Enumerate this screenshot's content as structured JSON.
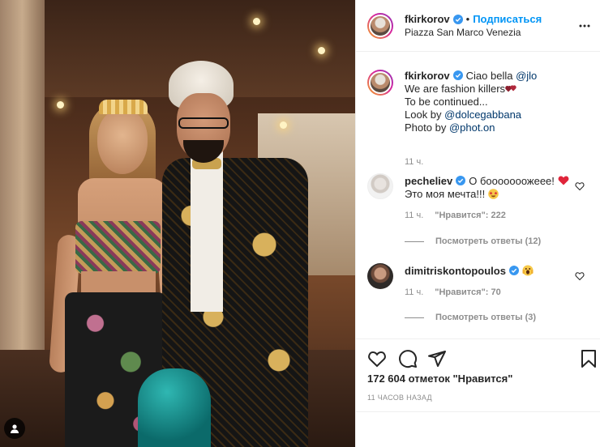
{
  "post": {
    "author": "fkirkorov",
    "follow_label": "Подписаться",
    "separator": "•",
    "location": "Piazza San Marco Venezia"
  },
  "caption": {
    "username": "fkirkorov",
    "line1_text": "Ciao bella ",
    "line1_mention": "@jlo",
    "line2": "We are fashion killers",
    "line3": "To be continued...",
    "line4_text": "Look by ",
    "line4_mention": "@dolcegabbana",
    "line5_text": "Photo by ",
    "line5_mention": "@phot.on",
    "time": "11 ч."
  },
  "comments": [
    {
      "username": "pecheliev",
      "text_line1": "О бооооооожеее! ",
      "text_line2": "Это моя мечта!!! ",
      "time": "11 ч.",
      "likes": "\"Нравится\": 222",
      "replies": "Посмотреть ответы (12)"
    },
    {
      "username": "dimitriskontopoulos",
      "text_line1": "",
      "time": "11 ч.",
      "likes": "\"Нравится\": 70",
      "replies": "Посмотреть ответы (3)"
    }
  ],
  "likes_total": "172 604 отметок \"Нравится\"",
  "date": "11 ЧАСОВ НАЗАД",
  "colors": {
    "accent_blue": "#0095f6",
    "mention_blue": "#00376b",
    "secondary_text": "#8e8e8e",
    "heart_red": "#ed4956"
  },
  "icons": {
    "verified": "verified-badge-icon",
    "more": "more-options-icon",
    "like": "heart-icon",
    "comment": "comment-icon",
    "share": "paper-plane-icon",
    "save": "bookmark-icon",
    "tagged": "user-tag-icon"
  }
}
